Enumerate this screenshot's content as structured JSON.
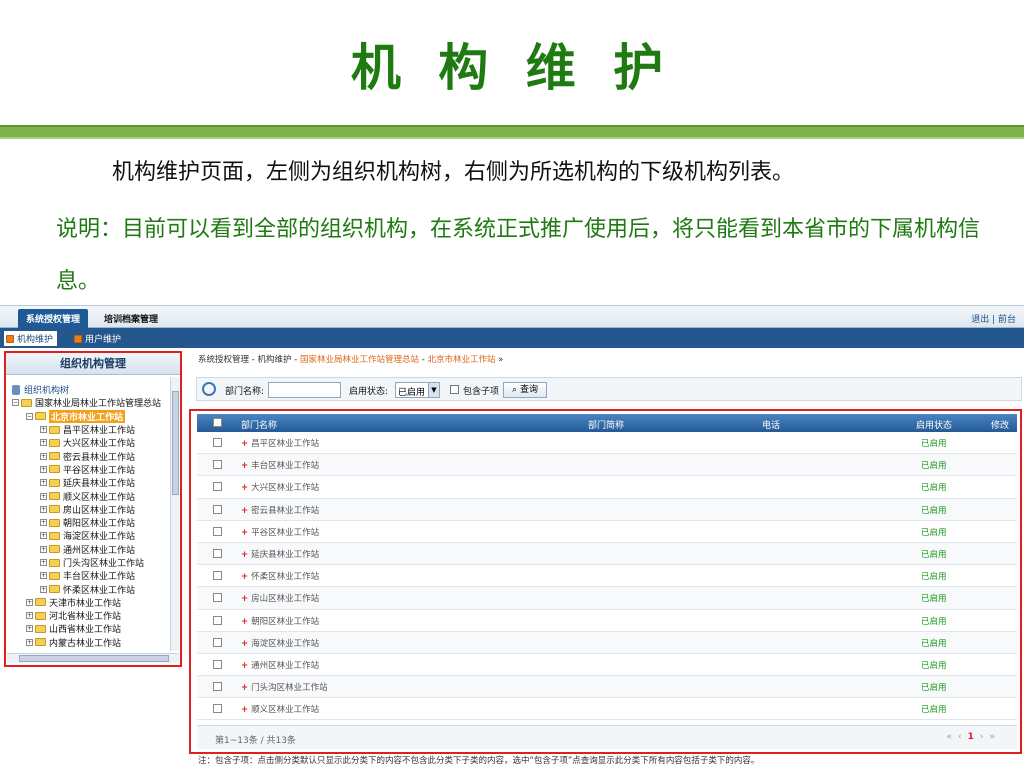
{
  "slide": {
    "title": "机 构 维 护",
    "desc1": "机构维护页面，左侧为组织机构树，右侧为所选机构的下级机构列表。",
    "desc2": "说明：目前可以看到全部的组织机构，在系统正式推广使用后，将只能看到本省市的下属机构信息。"
  },
  "topnav": {
    "tabs": [
      "系统授权管理",
      "培训档案管理"
    ],
    "links": "退出 | 前台"
  },
  "subnav": {
    "tabs": [
      "机构维护",
      "用户维护"
    ]
  },
  "leftpane": {
    "title": "组织机构管理",
    "tree": [
      {
        "label": "组织机构树",
        "level": 0,
        "kind": "root"
      },
      {
        "label": "国家林业局林业工作站管理总站",
        "level": 0,
        "kind": "minus"
      },
      {
        "label": "北京市林业工作站",
        "level": 1,
        "kind": "minus",
        "selected": true
      },
      {
        "label": "昌平区林业工作站",
        "level": 2,
        "kind": "plus"
      },
      {
        "label": "大兴区林业工作站",
        "level": 2,
        "kind": "plus"
      },
      {
        "label": "密云县林业工作站",
        "level": 2,
        "kind": "plus"
      },
      {
        "label": "平谷区林业工作站",
        "level": 2,
        "kind": "plus"
      },
      {
        "label": "延庆县林业工作站",
        "level": 2,
        "kind": "plus"
      },
      {
        "label": "顺义区林业工作站",
        "level": 2,
        "kind": "plus"
      },
      {
        "label": "房山区林业工作站",
        "level": 2,
        "kind": "plus"
      },
      {
        "label": "朝阳区林业工作站",
        "level": 2,
        "kind": "plus"
      },
      {
        "label": "海淀区林业工作站",
        "level": 2,
        "kind": "plus"
      },
      {
        "label": "通州区林业工作站",
        "level": 2,
        "kind": "plus"
      },
      {
        "label": "门头沟区林业工作站",
        "level": 2,
        "kind": "plus"
      },
      {
        "label": "丰台区林业工作站",
        "level": 2,
        "kind": "plus"
      },
      {
        "label": "怀柔区林业工作站",
        "level": 2,
        "kind": "plus"
      },
      {
        "label": "天津市林业工作站",
        "level": 1,
        "kind": "plus"
      },
      {
        "label": "河北省林业工作站",
        "level": 1,
        "kind": "plus"
      },
      {
        "label": "山西省林业工作站",
        "level": 1,
        "kind": "plus"
      },
      {
        "label": "内蒙古林业工作站",
        "level": 1,
        "kind": "plus"
      }
    ]
  },
  "breadcrumb": {
    "prefix": "系统授权管理 - 机构维护 - ",
    "link1": "国家林业局林业工作站管理总站",
    "sep": " - ",
    "link2": "北京市林业工作站",
    "suffix": " »"
  },
  "search": {
    "dept_label": "部门名称:",
    "dept_value": "",
    "status_label": "启用状态:",
    "status_value": "已启用",
    "include_sub_label": "包含子项",
    "query_button": "查询"
  },
  "table": {
    "headers": {
      "name": "部门名称",
      "abbr": "部门简称",
      "phone": "电话",
      "status": "启用状态",
      "edit": "修改"
    },
    "rows": [
      {
        "name": "昌平区林业工作站",
        "status": "已启用"
      },
      {
        "name": "丰台区林业工作站",
        "status": "已启用"
      },
      {
        "name": "大兴区林业工作站",
        "status": "已启用"
      },
      {
        "name": "密云县林业工作站",
        "status": "已启用"
      },
      {
        "name": "平谷区林业工作站",
        "status": "已启用"
      },
      {
        "name": "延庆县林业工作站",
        "status": "已启用"
      },
      {
        "name": "怀柔区林业工作站",
        "status": "已启用"
      },
      {
        "name": "房山区林业工作站",
        "status": "已启用"
      },
      {
        "name": "朝阳区林业工作站",
        "status": "已启用"
      },
      {
        "name": "海淀区林业工作站",
        "status": "已启用"
      },
      {
        "name": "通州区林业工作站",
        "status": "已启用"
      },
      {
        "name": "门头沟区林业工作站",
        "status": "已启用"
      },
      {
        "name": "顺义区林业工作站",
        "status": "已启用"
      }
    ],
    "footer_info": "第1~13条 / 共13条",
    "pager": {
      "first": "«",
      "prev": "‹",
      "current": "1",
      "next": "›",
      "last": "»"
    }
  },
  "note": "注：包含子项：点击侧分类默认只显示此分类下的内容不包含此分类下子类的内容，选中“包含子项”点查询显示此分类下所有内容包括子类下的内容。",
  "colors": {
    "title_green": "#1f7a12",
    "nav_blue": "#24578e",
    "highlight_red": "#e0201e",
    "status_green": "#1a9a1a"
  }
}
